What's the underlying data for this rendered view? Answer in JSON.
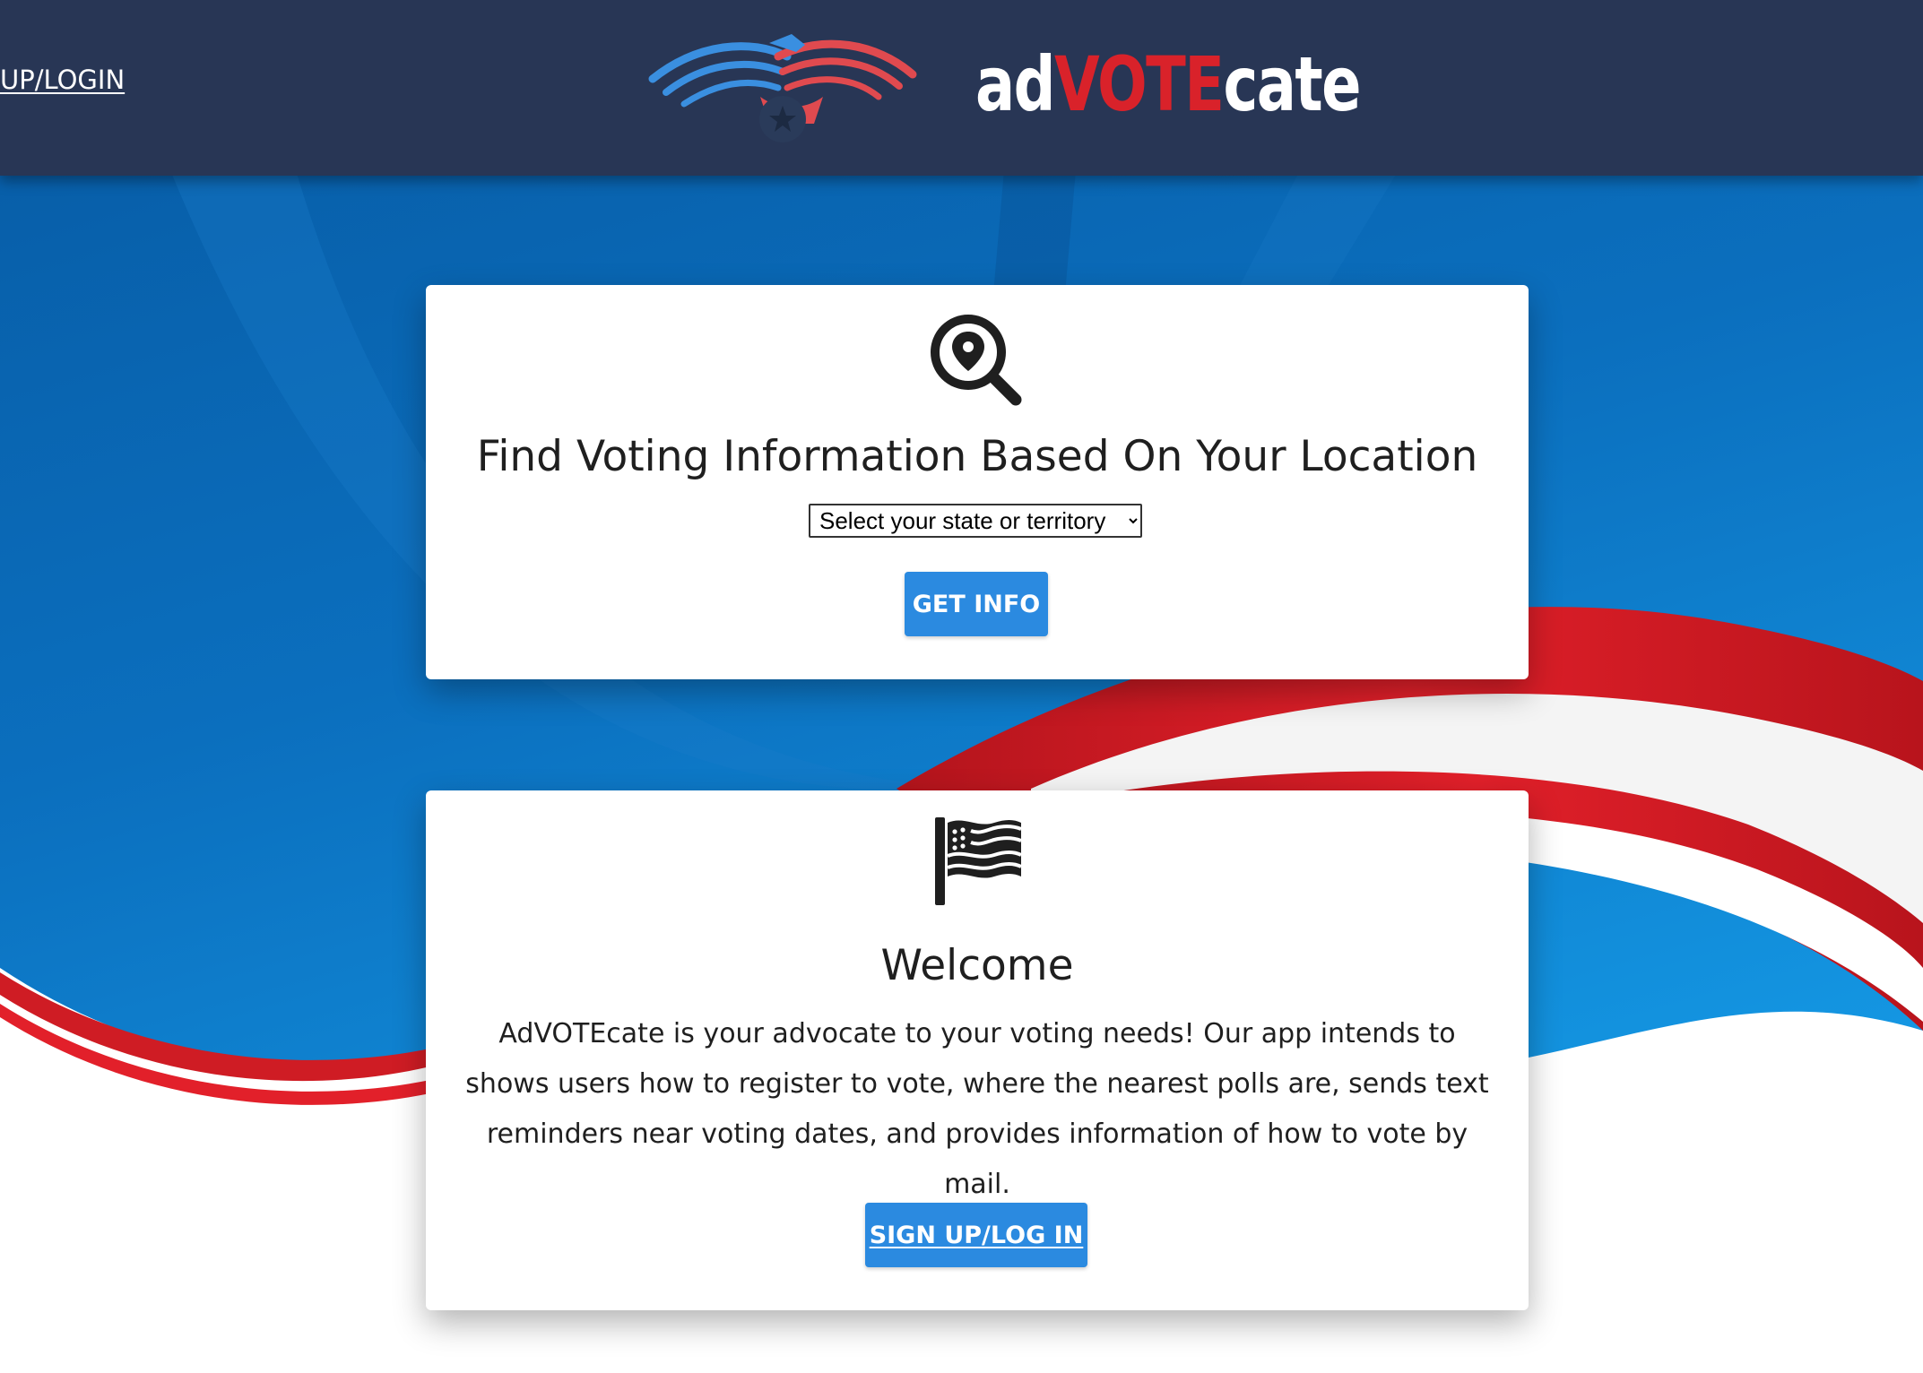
{
  "header": {
    "nav_link": "UP/LOGIN",
    "logo": {
      "word_prefix": "ad",
      "word_highlight": "VOTE",
      "word_suffix": "cate"
    }
  },
  "location_card": {
    "icon": "location-search-icon",
    "title": "Find Voting Information Based On Your Location",
    "select_value": "Select your state or territory",
    "button_label": "GET INFO"
  },
  "welcome_card": {
    "icon": "american-flag-icon",
    "title": "Welcome",
    "description": "AdVOTEcate is your advocate to your voting needs! Our app intends to shows users how to register to vote, where the nearest polls are, sends text reminders near voting dates, and provides information of how to vote by mail.",
    "button_label": "SIGN UP/LOG IN"
  },
  "colors": {
    "header_bg": "#283655",
    "accent_blue": "#2b8ae0",
    "accent_red": "#d9222a",
    "background_blue": "#0b66b3"
  }
}
